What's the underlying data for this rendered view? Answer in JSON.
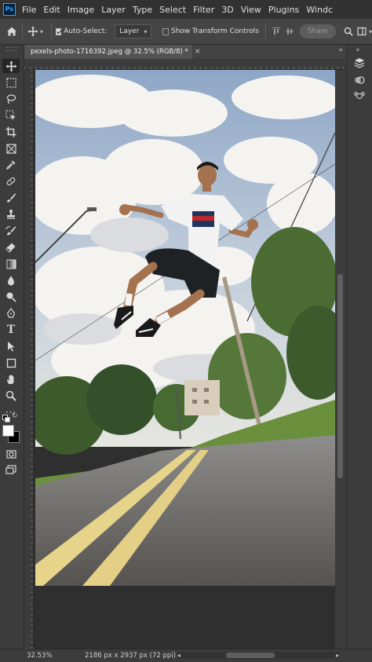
{
  "app": {
    "logo_text": "Ps",
    "menu": [
      "File",
      "Edit",
      "Image",
      "Layer",
      "Type",
      "Select",
      "Filter",
      "3D",
      "View",
      "Plugins",
      "Windc"
    ]
  },
  "options_bar": {
    "auto_select_label": "Auto-Select:",
    "auto_select_checked": true,
    "auto_select_target": "Layer",
    "show_transform_label": "Show Transform Controls",
    "show_transform_checked": false,
    "share_label": "Share"
  },
  "document": {
    "tab_title": "pexels-photo-1716392.jpeg @ 32.5% (RGB/8) *",
    "close_glyph": "×"
  },
  "tools": [
    "move-tool-icon",
    "artboard-marquee-icon",
    "lasso-icon",
    "object-select-icon",
    "crop-icon",
    "frame-icon",
    "eyedropper-icon",
    "healing-brush-icon",
    "brush-icon",
    "clone-stamp-icon",
    "history-brush-icon",
    "eraser-icon",
    "gradient-icon",
    "blur-icon",
    "dodge-icon",
    "pen-icon",
    "type-icon",
    "path-select-icon",
    "rectangle-icon",
    "hand-icon",
    "zoom-icon",
    "more-tools-icon"
  ],
  "colors": {
    "foreground": "#ffffff",
    "background": "#000000",
    "accent": "#31a8ff"
  },
  "status": {
    "zoom": "32.53%",
    "doc_info": "2186 px x 2937 px (72 ppi)",
    "arrow": ">"
  }
}
